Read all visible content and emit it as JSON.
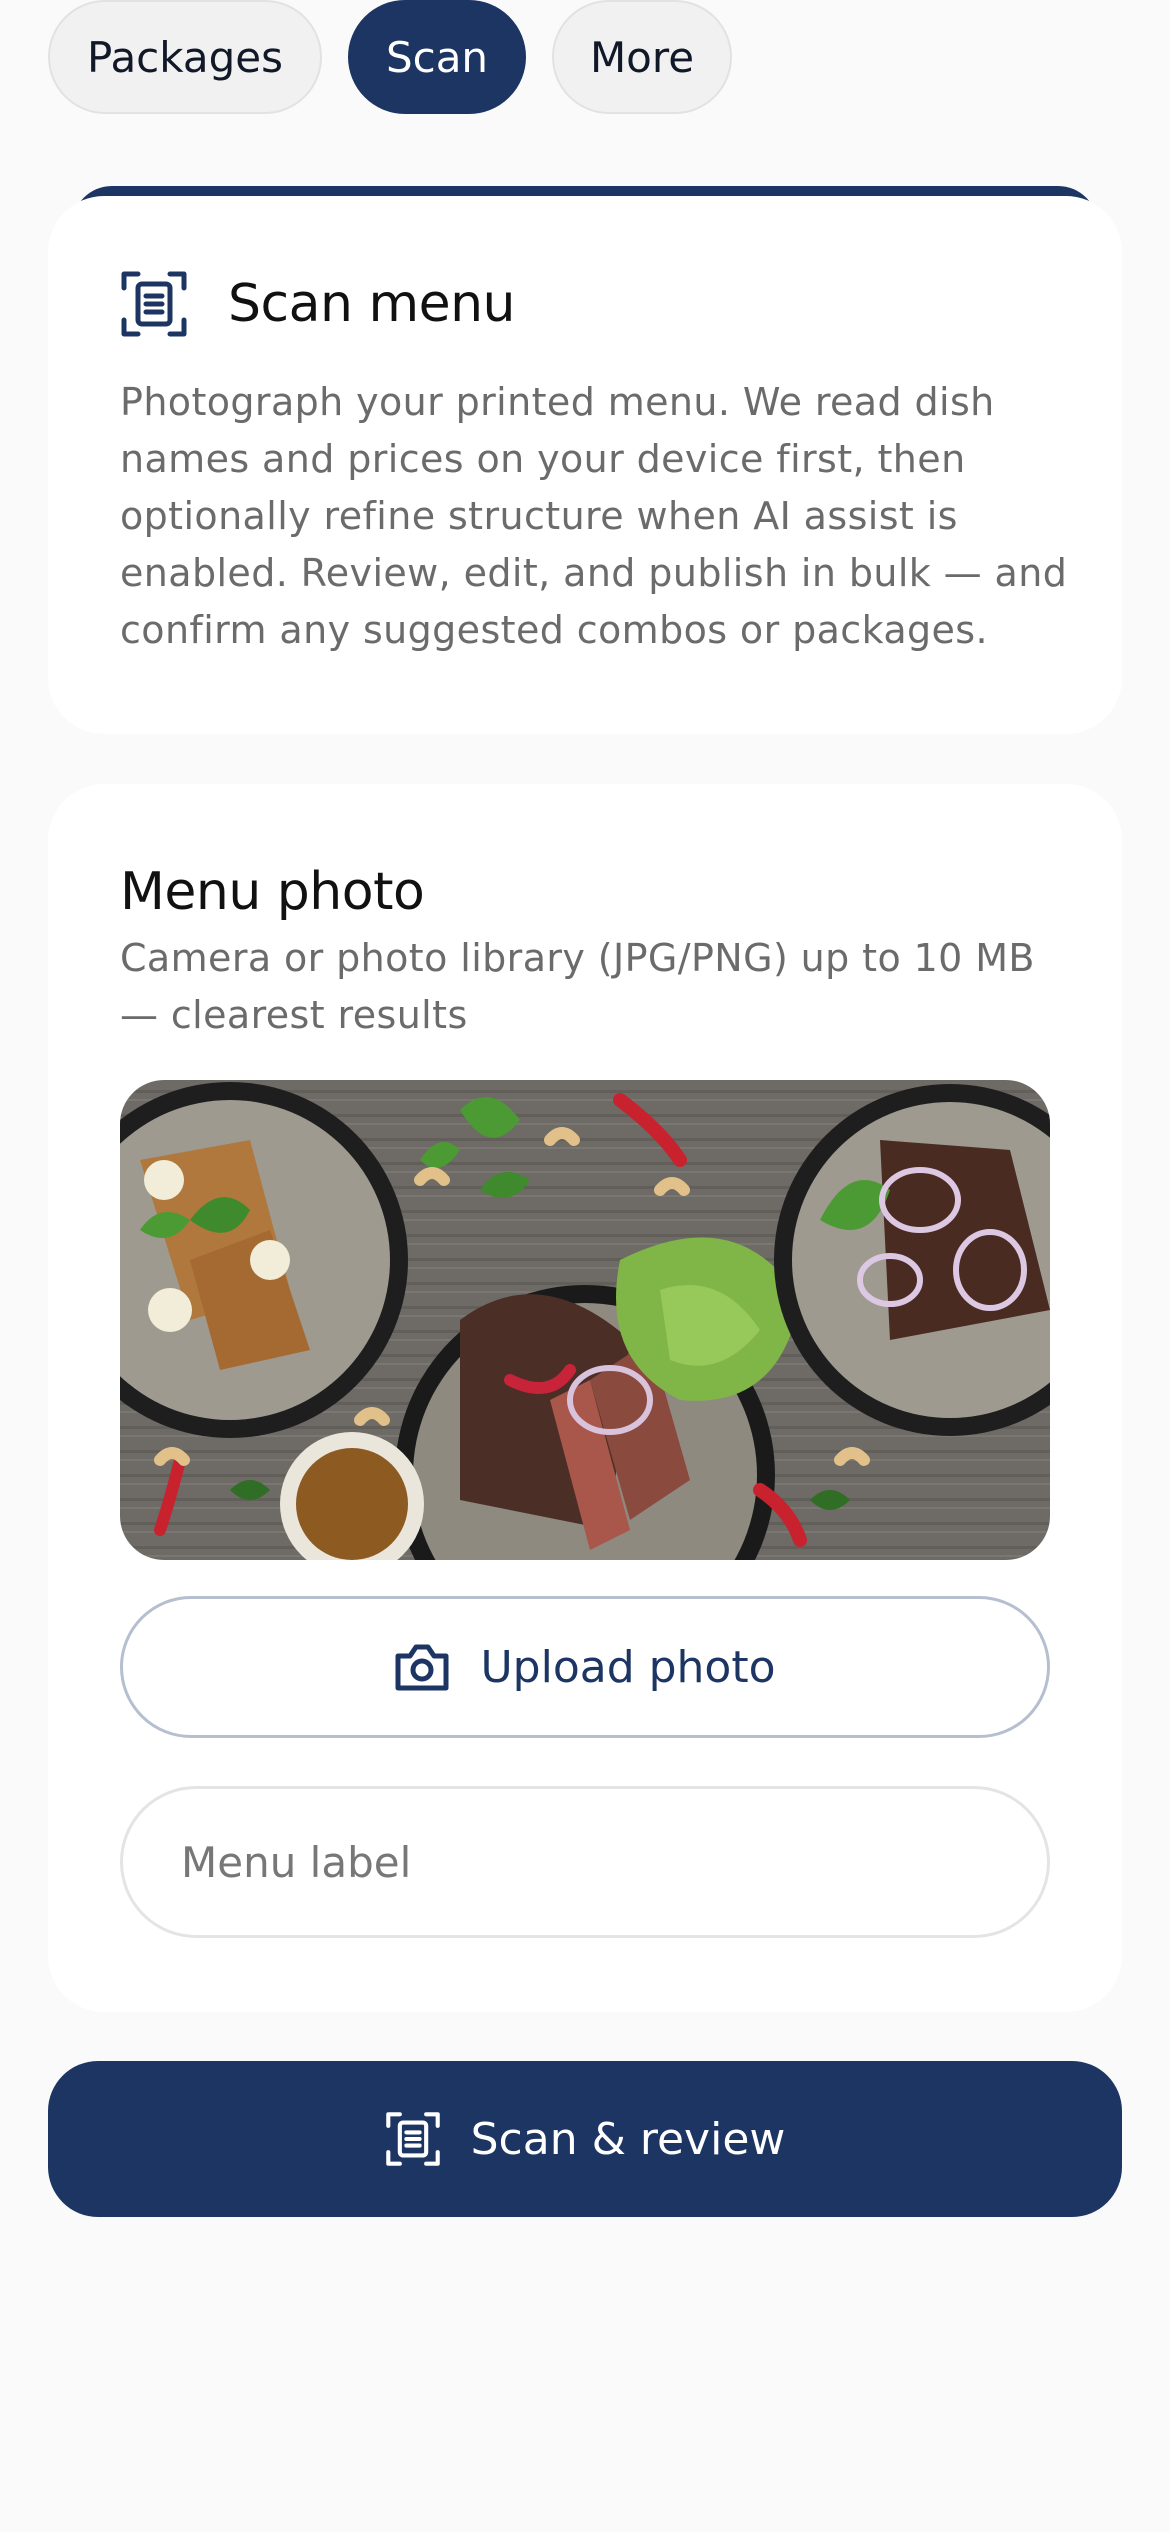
{
  "tabs": [
    {
      "label": "Packages",
      "active": false
    },
    {
      "label": "Scan",
      "active": true
    },
    {
      "label": "More",
      "active": false
    }
  ],
  "intro_card": {
    "icon": "scan-document-icon",
    "title": "Scan menu",
    "description": "Photograph your printed menu. We read dish names and prices on your device first, then optionally refine structure when AI assist is enabled. Review, edit, and publish in bulk — and confirm any suggested combos or packages."
  },
  "photo_card": {
    "title": "Menu photo",
    "subtitle": "Camera or photo library (JPG/PNG) up to 10 MB — clearest results",
    "upload_icon": "camera-icon",
    "upload_label": "Upload photo",
    "menu_label_placeholder": "Menu label",
    "menu_label_value": ""
  },
  "primary_action": {
    "icon": "scan-document-icon",
    "label": "Scan & review"
  },
  "colors": {
    "accent": "#1c3563",
    "background": "#fafafa",
    "card": "#ffffff",
    "muted_text": "#6b6b6b"
  }
}
